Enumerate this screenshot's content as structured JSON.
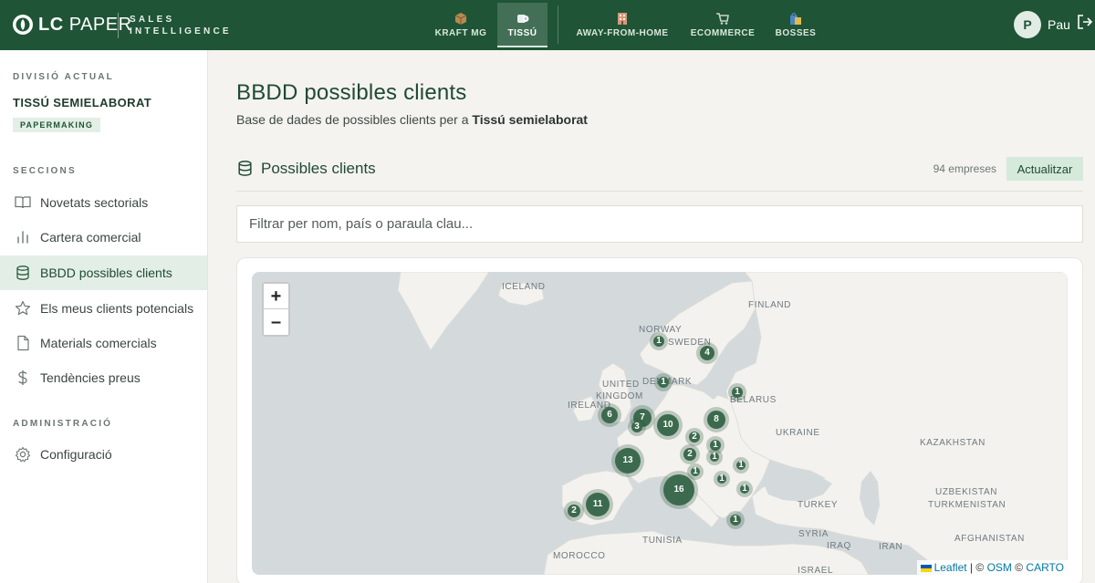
{
  "brand": {
    "name_bold": "LC",
    "name_light": "PAPER",
    "sub_line1": "SALES",
    "sub_line2": "INTELLIGENCE"
  },
  "topnav": [
    {
      "label": "KRAFT MG",
      "active": false
    },
    {
      "label": "TISSÚ",
      "active": true
    },
    {
      "label": "AWAY-FROM-HOME",
      "active": false
    },
    {
      "label": "ECOMMERCE",
      "active": false
    },
    {
      "label": "BOSSES",
      "active": false
    }
  ],
  "user": {
    "initial": "P",
    "name": "Pau"
  },
  "sidebar": {
    "division_caption": "DIVISIÓ ACTUAL",
    "division_name": "TISSÚ SEMIELABORAT",
    "division_tag": "PAPERMAKING",
    "sections_caption": "SECCIONS",
    "items": [
      {
        "label": "Novetats sectorials",
        "icon": "book-icon",
        "active": false
      },
      {
        "label": "Cartera comercial",
        "icon": "bar-chart-icon",
        "active": false
      },
      {
        "label": "BBDD possibles clients",
        "icon": "database-icon",
        "active": true
      },
      {
        "label": "Els meus clients potencials",
        "icon": "star-icon",
        "active": false
      },
      {
        "label": "Materials comercials",
        "icon": "file-icon",
        "active": false
      },
      {
        "label": "Tendències preus",
        "icon": "dollar-icon",
        "active": false
      }
    ],
    "admin_caption": "ADMINISTRACIÓ",
    "admin_items": [
      {
        "label": "Configuració",
        "icon": "gear-icon"
      }
    ]
  },
  "main": {
    "title": "BBDD possibles clients",
    "subtitle_prefix": "Base de dades de possibles clients per a",
    "subtitle_bold": "Tissú semielaborat",
    "section_title": "Possibles clients",
    "count": "94 empreses",
    "refresh_label": "Actualitzar",
    "filter_placeholder": "Filtrar per nom, país o paraula clau..."
  },
  "map": {
    "zoom_in": "+",
    "zoom_out": "–",
    "attribution": {
      "leaflet": "Leaflet",
      "sep": " | © ",
      "osm": "OSM",
      "sep2": " © ",
      "carto": "CARTO"
    },
    "labels": [
      "ICELAND",
      "FINLAND",
      "NORWAY",
      "SWEDEN",
      "UNITED",
      "KINGDOM",
      "IRELAND",
      "DENMARK",
      "BELARUS",
      "UKRAINE",
      "KAZAKHSTAN",
      "UZBEKISTAN",
      "TURKMENISTAN",
      "TURKEY",
      "AFGHANISTAN",
      "SYRIA",
      "IRAQ",
      "IRAN",
      "ISRAEL",
      "TUNISIA",
      "MOROCCO"
    ],
    "clusters": [
      "1",
      "4",
      "1",
      "1",
      "6",
      "7",
      "3",
      "10",
      "8",
      "2",
      "1",
      "2",
      "1",
      "13",
      "1",
      "1",
      "1",
      "16",
      "1",
      "11",
      "2",
      "1"
    ]
  }
}
